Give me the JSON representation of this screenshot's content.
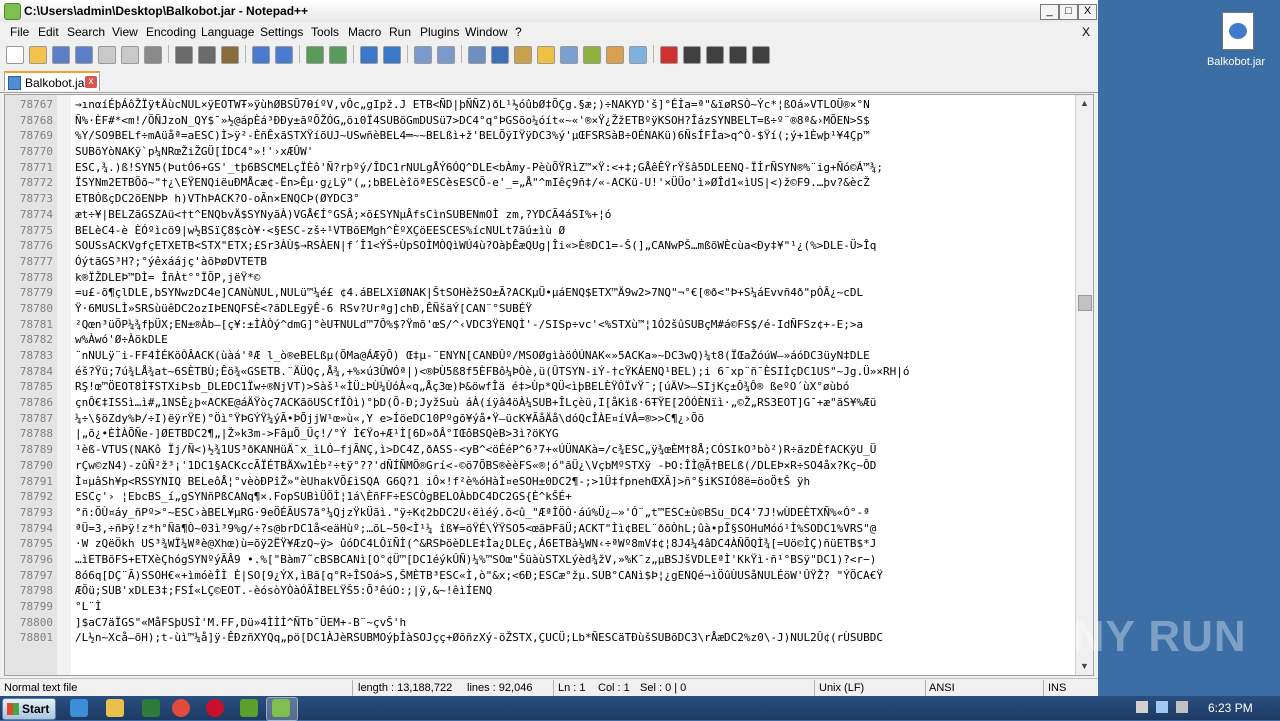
{
  "window": {
    "title": "C:\\Users\\admin\\Desktop\\Balkobot.jar - Notepad++",
    "minimize": "_",
    "maximize": "□",
    "close": "X"
  },
  "menu": {
    "items": [
      "File",
      "Edit",
      "Search",
      "View",
      "Encoding",
      "Language",
      "Settings",
      "Tools",
      "Macro",
      "Run",
      "Plugins",
      "Window",
      "?"
    ],
    "doc_close": "X"
  },
  "toolbar": {
    "icons": [
      "new-file-icon",
      "open-file-icon",
      "save-icon",
      "save-all-icon",
      "close-icon",
      "close-all-icon",
      "print-icon",
      "cut-icon",
      "copy-icon",
      "paste-icon",
      "undo-icon",
      "redo-icon",
      "find-icon",
      "replace-icon",
      "zoom-in-icon",
      "zoom-out-icon",
      "sync-vertical-icon",
      "sync-horizontal-icon",
      "word-wrap-icon",
      "show-all-chars-icon",
      "indent-guide-icon",
      "udl-icon",
      "doc-map-icon",
      "function-list-icon",
      "folder-workspace-icon",
      "monitor-icon",
      "record-macro-icon",
      "stop-macro-icon",
      "play-macro-icon",
      "run-macro-multiple-icon",
      "save-macro-icon"
    ]
  },
  "tab": {
    "label": "Balkobot.jar",
    "close": "x"
  },
  "editor": {
    "lines": [
      {
        "n": "78767",
        "t": "→ınαíÉþÁôŽÏÿŧÄùcNUL×ÿEOTWŦ»ÿùhØBSŨ7ƟíºV,vÔc„gIpž.J ETB<ÑD|þÑÑZ)ðL¹½óûbØ‡ÕÇg.§æ;)÷NAKYD'š]°Éİa=ª\"&ïøRSÒ~Ýc*¦ßOá»VTLOÜ®×°N"
      },
      {
        "n": "78768",
        "t": "Ñ%·ÈF#*<m!/ÕÑJzoN_QY$¯»½@ápÈá³ÐÐy±ãºÕŽÓG„öı0Ï4SUBõGmDUSü7>DC4°q°ÞGSõo¼óít«~«'®×Ÿ¿ŽžETBºÿKSOH?ÎázSYNBELT=ß÷º¨®8ª&›MÕEN>S$"
      },
      {
        "n": "78769",
        "t": "%Y/SO9BELf÷mAüåª=aESC)Ì>ÿ²-ÈñÊxãSTXŸíõUJ~USwñèBEL4═~~BELßì+ž'BELÕÿIŸÿDC3%ý'µŒFSRSàB÷OÉNAKü)6ÑsÍFÎa>q^Ò-$Ÿí(;ý+1Èwþ¹¥4Çp™"
      },
      {
        "n": "78770",
        "t": "SUBõYòNAKÿ`p¼NRœŽiŽGÜ[ÍDC4°»!'›xÆÛW'"
      },
      {
        "n": "78771",
        "t": "ESC,¾.)ß!SYN5(ÞutÓ6+GS'_tþ6BSCMELçÏÈô'Ñ?rþºý/ÎDC1rNULgÅÝ6ÓQ^DLE<bÀmy-PèùÕŸRìZ™×Ÿ:<+‡;GÅêÊŸrŸšâ5DLEENQ-ÏİrÑSYN®%¨ig+Ñó©Á™¾;"
      },
      {
        "n": "78772",
        "t": "ÏSYNm2ETBÕõ~\"†¿\\EŸENQiëuÐMÅcæ¢-Ën>Êµ·g¿Lÿ\"(„;bBELèîöªESCèsESCÕ-e'_=„Å\"^mIêç9ñ‡/«-ACKü-U!'×ÜÜo'ì»ØÎd1«ìUS|<)ž©F9.…þv?&ècŽ"
      },
      {
        "n": "78773",
        "t": "ETBÓßçDC2õENÞÞ h)VThÞACK?O-oÃn×ENQCÞ(ØYDC3°"
      },
      {
        "n": "78774",
        "t": "æt÷¥|BELZãGSZAü<†t^ENQbvÄ$SYNyãÀ)VGÅ€Í°GSÂ;×õ£SYNµÂfsCìnSUBENmOÌ zm,?YDCÃ4áSI%+¦ó"
      },
      {
        "n": "78775",
        "t": "BELèC4-è ÈÓºìcö9|w½BSïÇ8$cò¥·<§ESC-zš÷¹VTBõEMgh^ÈºXÇöEESCES%ícNULt7ãú±ìù Ø"
      },
      {
        "n": "78776",
        "t": "SOUSsACKVgfçETXETB<STX\"ETX;£Sr3ÀÙ$→RSÀEN|f´Î1<ÝŠ÷ÙpSOÌMÒQìWÚ4ù?OàþÊæQUg|Îi«>È®DC1=-Š(]„CANwPŠ…mßõWÈcùa<Ðy‡¥\"¹¿(%>DLE-Ü>Îq"
      },
      {
        "n": "78777",
        "t": "ÓýtãGS³H?;°ýêxáájç'àõÞøDVTETB"
      },
      {
        "n": "78778",
        "t": "k®ÏŽDLEÞ™DÌ= ÎñÀt°°ÏÕP,jëŸ*©"
      },
      {
        "n": "78779",
        "t": "=u£-õ¶çlDLE,bSYNwzDC4e]CANùNUL,NULü™¼é£ ¢4.áBELXïØNAK|ŠtSOHèžSO±Ã?ACKµÜ•µáENQ$ETX™Ä9w2>7NQ\"¬°€[®ð<\"Þ+S¼áEvvñ4ð\"pÒÂ¿~cDL"
      },
      {
        "n": "78780",
        "t": "Ÿ·6MUSLÌ»SRSùüêDC2ozIÞENQFSÈ<?ãDLEgÿÊ-6 RSv?Urªg]chÐ,ÊÑšäÝ[CAN¨°SUBÉŸ"
      },
      {
        "n": "78781",
        "t": "²Qœn³üÖP¼¾fþÜX;EN±®Àb—[ç¥:±ÌÀÒý^dmG]°èUŦNULd™7Ô%$?Ÿmõ'œS/^‹VDC3ŸENQÌ'-/SISp÷vc'<%STXù™¦1Ó2šûSUBçM#á©FS$/é-IdÑFSz¢+-E;>a"
      },
      {
        "n": "78782",
        "t": "w%Àwó'Ø÷ÀökDLE"
      },
      {
        "n": "78783",
        "t": "¨nNULÿ¨i-FF4ÌÉKöÒÂACK(ùàá'ªÆ l_ò®eBELßµ(ÕMa@ÁÆÿÕ) Œ‡µ-¨ENYN[CANÐÛº/MSOØgìàöÓÚNAK«»5ACKa»~DC3wQ)¼t8(ÏŒaŽóúW—»áóDC3üyN‡DLE"
      },
      {
        "n": "78784",
        "t": "éš?Ÿü;7ú¾LÅ¾at~6SÈTBÙ;Êö¾«GSETB.¨ÄÜQç,Å¾,+%×ú3ÛWÓª|)<®ÞÙ5ß8f5ÈFBô¼ÞÒè,ü(ÛTSYN-iÝ-†cŸKÁENQ¹BEL);i 6¯xp¨ñ¯ÈSIÌçDC1US\"~Jg.Ü»×RH|ó"
      },
      {
        "n": "78785",
        "t": "RŞ!œ™ÖEOT8ÌŦSTXiÞsb_DLEDC1Ïw÷®NjVT)>Sàš¹«ÌÜ߸ÞÙ¼ÙóÀ«q„Åç3œ)Þ&öwfÎä é‡>Ùp*QÜ<ìþBELÈŸÔÏvŸ¯;[úÄV>—SIjKç±Ô¾Ô® ßeºO´ùX°øùbó"
      },
      {
        "n": "78786",
        "t": "çnÔ€‡ISSì…ì#„1NSÈ¿þ«ACKE@áÄŸòç7ACKãöUSCfÏÒì)°þD(Õ-Ð;JyžSuù áÀ(íÿâ4öÀ¼SUB+ÎLçèü,I[åKìß·6ŦŸE[2ÓÓÈNïì·„©Ž„RS3EOT]G¯+æ\"ãS¥%Æü"
      },
      {
        "n": "78787",
        "t": "¼÷\\§öZdy%Þ/÷I)ëÿrŸE)°Öì°ŸÞGÝŸ¼ýÃ•ÞÕjjW¹œ»ù«,Y e>ÍöeDC10Pºgõ¥ýå•Ÿ—ücK¥ÃåÄå\\dóQcÎÀE¤íVÂ=®>>C¶¿›Õõ"
      },
      {
        "n": "78788",
        "t": "|„õ¿•ÈÌÀÕÑe-]ØETBDC2¶„|Ž»k3m->FâµÕ_Üç!/°Ý Ì€Ÿo+Æ¹Ì[6D»ðÂ°IŒôBSQèB>3ì?öKYG"
      },
      {
        "n": "78789",
        "t": "¹èß-VTUS(NAKô Ïj/Ñ<)½¾1US³ðKANHüÄ¯x_ìLÓ—fjÃNÇ,ì>DC4Z,ðASS-<yB^<öÉéP^6³7+«ÚÜNAKà=/c¾ESC„ÿ¾œÈM†8Å;CÓSIkO³bò²)R÷ãzDÈfACKÿU_Ü"
      },
      {
        "n": "78790",
        "t": "rÇw©zN4)-zûÑ²ž³¡'1DC1§ACKccÃÏÉTBÄXw1Èb²÷ŧÿ°??'dÑÍÑMÖ®Grí<-©ö7ÕBS®èèFS«®¦ó\"ãÜ¿\\VçbMºSTXÿ -ÞO:ÎÌ@Ã†BELß(/DLEÞ×R÷SO4åx?Kç~ÔD"
      },
      {
        "n": "78791",
        "t": "Ì¤µâSh¥p<RSSYNIQ BELeôÅ¦°vèòÐPîŽ»\"èUhakVÕ£ìSQA G6Q?1 iÔ×!f²è%óHàÌ¤eSOH±0DC2¶-;>1Ü‡fpnehŒXÃ]>ñ°§iKSIÓ8ë=öoÖŧŠ ÿh"
      },
      {
        "n": "78792",
        "t": "ESCç'› ¦EbcBS_í„gSYNñPßCANq¶×.FopSUBìÜÕÌ¦1á\\ÈñFF÷ESCÒgBELOÀbDC4DC2GS{È^kŠÉ+"
      },
      {
        "n": "78793",
        "t": "°ñ:ÖÙ¤áy_ñPº>°~ESC›àBEL¥µRG·9eÖÉÃUS7ã°¼QjzŸkÜãì.\"ÿ÷K¢2bDC2U‹ëìéý.õ<û_\"ÆªÎÖÒ·áú%Ü¿—»'Ó¨„t™ESC±ù©BSu_DC4'7J!wÙDEÈTXÑ%«Ó°-ª"
      },
      {
        "n": "78794",
        "t": "ªÜ=3,÷ñÞÿ!z*h°Ñã¶Ò~03ì³9%g/÷?s@brDC1å<eäHùº;…õL~50<Ì¹¼ îß¥=öŸÉ\\ŸŸSO5<œãÞFãÜ;ACKT\"Ìì¢BEL¨ðõÒhL;ûà•pÎ§SOHuMóó¹Ì%SODC1%VRS\"@"
      },
      {
        "n": "78795",
        "t": "·W zQëÖkh US³¾WÏ¼Wªè@Xhœ)ù=õÿ2ËŸ¥ÆzQ~ÿ> ûóDC4LÔïÑÌ(^&RSÞöèDLE‡Ìa¿DLEç,Á6ETBà¼WN‹÷ªWº8mV‡¢¦8J4¼4âDC4ÀÑÕQÌ¾[=Uö©ÌÇ)ñüETB$*J"
      },
      {
        "n": "78796",
        "t": "…ìETBõFS+ETXèÇhógSYNºýÃÂ9 •.%[\"Bàm7˜cBSBCANì[O°¢Ü™[DC1éýkÛÑ)¼%™SOœ\"ŠüàùSTXLýèd¾žV,»%K¯z„µBSJšVDLEªÌ'KkŸì·ñ¹°BSÿ\"DC1)?<r−)"
      },
      {
        "n": "78797",
        "t": "8ó6q[DÇ¨Ã)SSOH€«+ìmóèÎÌ È|SO[9¿ÝX,ìBã[q°R÷ÎSOá>S,ŠMÈTB³ESC«Ì,ò\"&x;<6Ð;ESCæ°žµ.SUB°CANì$Þ¦¿gENQé¬ìÖûÙUSåNULÉöW'ÛŸŽ? \"ÝÖCA€Ÿ"
      },
      {
        "n": "78798",
        "t": "ÆÕü;SUB'xDLE3‡;FSÍ«LÇ©EOT.-èósòYÒàÓÃÌBELŸŠ5:Õ³êúO:;|ÿ,&~!êìÍENQ"
      },
      {
        "n": "78799",
        "t": "°L¨Ì"
      },
      {
        "n": "78800",
        "t": "]$aC7äÏGS\"«MåFSþUSÌ'M.FF,Dü»4ÌÌÌ^ÑTb¯ÜEM+-B¨~çvŠ'h"
      },
      {
        "n": "78801",
        "t": "/L½n~Xcå—õH);t-ùì™¼å]ÿ-ÊÐzñXYQq„pö[DC1ÀJèRSUBMOýþÌàSOJçç+ØõñzXý-öŽSTX,ÇUCÜ;Lb*ÑESCäTÐùšSUBõDC3\\rÅæDC2%z0\\-J)NUL2Û¢(rÙSUBDC"
      }
    ]
  },
  "status": {
    "file_type": "Normal text file",
    "length": "length : 13,188,722",
    "lines": "lines : 92,046",
    "ln": "Ln : 1",
    "col": "Col : 1",
    "sel": "Sel : 0 | 0",
    "eol": "Unix (LF)",
    "encoding": "ANSI",
    "ins": "INS"
  },
  "desktop": {
    "icon_label": "Balkobot.jar",
    "watermark": "ANY RUN"
  },
  "taskbar": {
    "start_label": "Start",
    "clock": "6:23 PM"
  },
  "colors": {
    "desktop": "#3a6ea5",
    "taskbar": "#1d3a63",
    "tab_accent": "#f0a030",
    "control_char_bg": "#000000"
  }
}
